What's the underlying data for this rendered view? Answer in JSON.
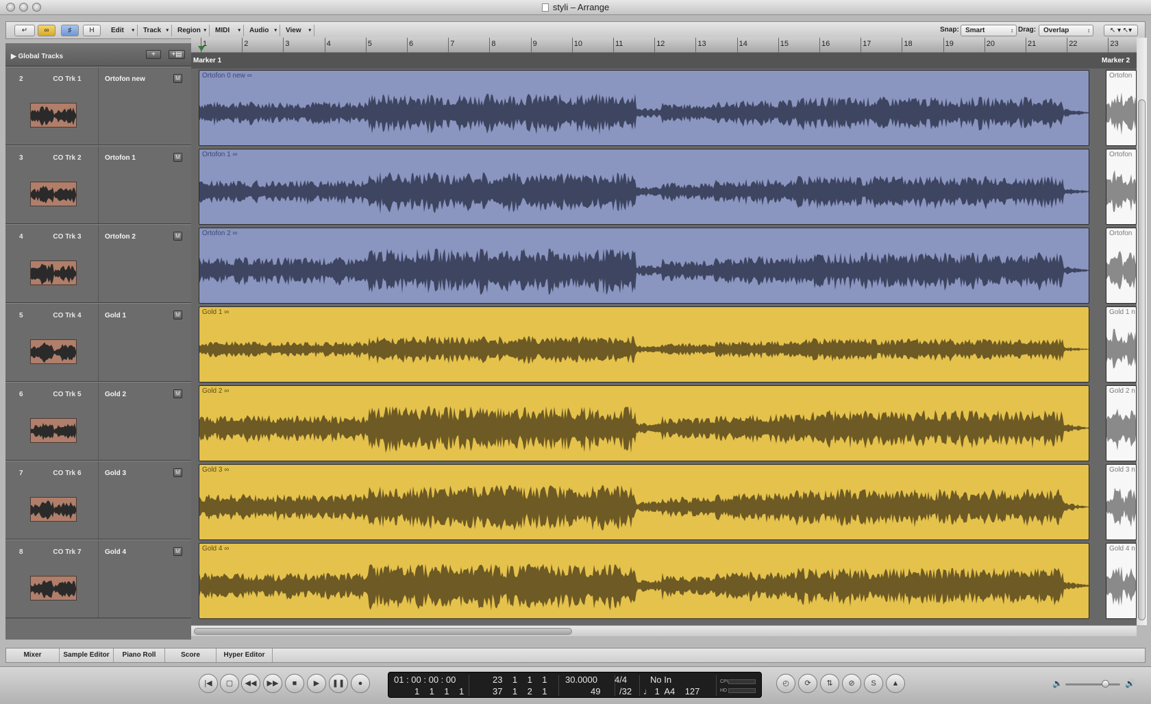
{
  "window": {
    "title": "styli – Arrange"
  },
  "toolbar": {
    "menus": [
      "Edit",
      "Track",
      "Region",
      "MIDI",
      "Audio",
      "View"
    ],
    "h_button": "H",
    "snap_label": "Snap:",
    "snap_value": "Smart",
    "drag_label": "Drag:",
    "drag_value": "Overlap"
  },
  "global_tracks": {
    "label": "Global Tracks"
  },
  "tracks": [
    {
      "num": "2",
      "inst": "CO Trk 1",
      "name": "Ortofon new",
      "mute": "M"
    },
    {
      "num": "3",
      "inst": "CO Trk 2",
      "name": "Ortofon 1",
      "mute": "M"
    },
    {
      "num": "4",
      "inst": "CO Trk 3",
      "name": "Ortofon 2",
      "mute": "M"
    },
    {
      "num": "5",
      "inst": "CO Trk 4",
      "name": "Gold 1",
      "mute": "M"
    },
    {
      "num": "6",
      "inst": "CO Trk 5",
      "name": "Gold 2",
      "mute": "M"
    },
    {
      "num": "7",
      "inst": "CO Trk 6",
      "name": "Gold 3",
      "mute": "M"
    },
    {
      "num": "8",
      "inst": "CO Trk 7",
      "name": "Gold 4",
      "mute": "M"
    }
  ],
  "ruler": {
    "bars": [
      "1",
      "2",
      "3",
      "4",
      "5",
      "6",
      "7",
      "8",
      "9",
      "10",
      "11",
      "12",
      "13",
      "14",
      "15",
      "16",
      "17",
      "18",
      "19",
      "20",
      "21",
      "22",
      "23"
    ],
    "markers": [
      "Marker 1",
      "Marker 2"
    ]
  },
  "regions": [
    {
      "name": "Ortofon 0 new ∞",
      "tail": "Ortofon",
      "color": "blue"
    },
    {
      "name": "Ortofon 1 ∞",
      "tail": "Ortofon",
      "color": "blue"
    },
    {
      "name": "Ortofon 2 ∞",
      "tail": "Ortofon",
      "color": "blue"
    },
    {
      "name": "Gold 1 ∞",
      "tail": "Gold 1 n",
      "color": "gold"
    },
    {
      "name": "Gold 2 ∞",
      "tail": "Gold 2 n",
      "color": "gold"
    },
    {
      "name": "Gold 3 ∞",
      "tail": "Gold 3 n",
      "color": "gold"
    },
    {
      "name": "Gold 4 ∞",
      "tail": "Gold 4 n",
      "color": "gold"
    }
  ],
  "bottom_tabs": [
    "Mixer",
    "Sample Editor",
    "Piano Roll",
    "Score",
    "Hyper Editor"
  ],
  "transport": {
    "smpte": "01 : 00 : 00 : 00",
    "bbt": "1    1    1    1",
    "pos_top": "23    1    1    1",
    "pos_bottom": "37    1    2    1",
    "tempo": "30.0000",
    "tempo_sub": "49",
    "sig": "4/4",
    "div": "/32",
    "midi_in": "No In",
    "midi_out": "♩ 1  A4    127",
    "cpu_label": "CPU",
    "hd_label": "HD"
  },
  "colors": {
    "audio_blue": "#8a95c0",
    "audio_gold": "#e4c24c",
    "waveform_blue": "#3e4560",
    "waveform_gold": "#6e5a24"
  }
}
